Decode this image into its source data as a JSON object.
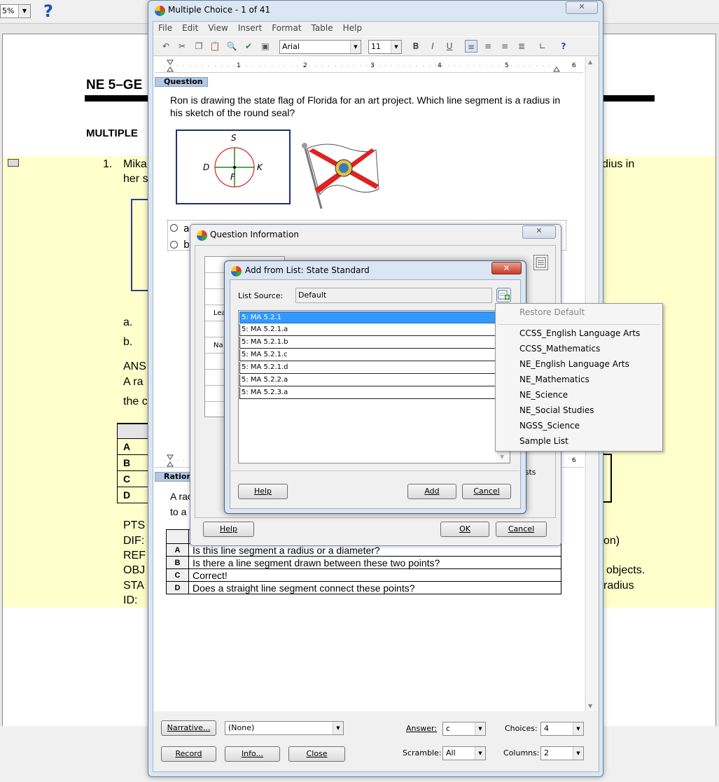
{
  "background": {
    "zoom": "5%",
    "doc_title": "NE 5–GE",
    "section": "MULTIPLE",
    "q_num": "1.",
    "q_text_1": "Mika",
    "q_text_2": "her s",
    "q_text_right": "dius in",
    "opt_a": "a.",
    "opt_b": "b.",
    "ans": "ANS",
    "ans_text": "A ra",
    "ans_text2": "the c",
    "table_keys": [
      "A",
      "B",
      "C",
      "D"
    ],
    "meta": [
      "PTS",
      "DIF:",
      "REF",
      "OBJ",
      "STA",
      "ID:"
    ],
    "meta_right": [
      "on)",
      "objects.",
      "radius"
    ]
  },
  "mc_window": {
    "title": "Multiple Choice - 1 of 41",
    "menu": [
      "File",
      "Edit",
      "View",
      "Insert",
      "Format",
      "Table",
      "Help"
    ],
    "font": "Arial",
    "size": "11",
    "question_tab": "Question",
    "question_text": "Ron is drawing the state flag of Florida for an art project. Which line segment is a radius in his sketch of the round seal?",
    "figure_labels": {
      "top": "S",
      "left": "D",
      "right": "K",
      "bottom": "F"
    },
    "choices": [
      "a",
      "b"
    ],
    "rationale_tab": "Rationa",
    "rationale_text_1": "A rac",
    "rationale_text_2": "to a",
    "rationale_rows": [
      {
        "key": "A",
        "text": "Is this line segment a radius or a diameter?"
      },
      {
        "key": "B",
        "text": "Is there a line segment drawn between these two points?"
      },
      {
        "key": "C",
        "text": "Correct!"
      },
      {
        "key": "D",
        "text": "Does a straight line segment connect these points?"
      }
    ],
    "ruler_nums": [
      "1",
      "2",
      "3",
      "4",
      "5",
      "6"
    ],
    "buttons": {
      "narrative": "Narrative...",
      "record": "Record",
      "info": "Info...",
      "close": "Close"
    },
    "narrative_value": "(None)",
    "answer_label": "Answer:",
    "answer_value": "c",
    "choices_label": "Choices:",
    "choices_value": "4",
    "scramble_label": "Scramble:",
    "scramble_value": "All",
    "columns_label": "Columns:",
    "columns_value": "2"
  },
  "qi_dialog": {
    "title": "Question Information",
    "grid_labels": [
      "Lea",
      "Na"
    ],
    "side_text": "ests",
    "help": "Help",
    "ok": "OK",
    "cancel": "Cancel"
  },
  "af_dialog": {
    "title": "Add from List: State Standard",
    "list_source_label": "List Source:",
    "list_source_value": "Default",
    "items": [
      "5: MA 5.2.1",
      "5: MA 5.2.1.a",
      "5: MA 5.2.1.b",
      "5: MA 5.2.1.c",
      "5: MA 5.2.1.d",
      "5: MA 5.2.2.a",
      "5: MA 5.2.3.a"
    ],
    "help": "Help",
    "add": "Add",
    "cancel": "Cancel"
  },
  "context_menu": {
    "restore": "Restore Default",
    "items": [
      "CCSS_English Language Arts",
      "CCSS_Mathematics",
      "NE_English Language Arts",
      "NE_Mathematics",
      "NE_Science",
      "NE_Social Studies",
      "NGSS_Science",
      "Sample List"
    ]
  }
}
